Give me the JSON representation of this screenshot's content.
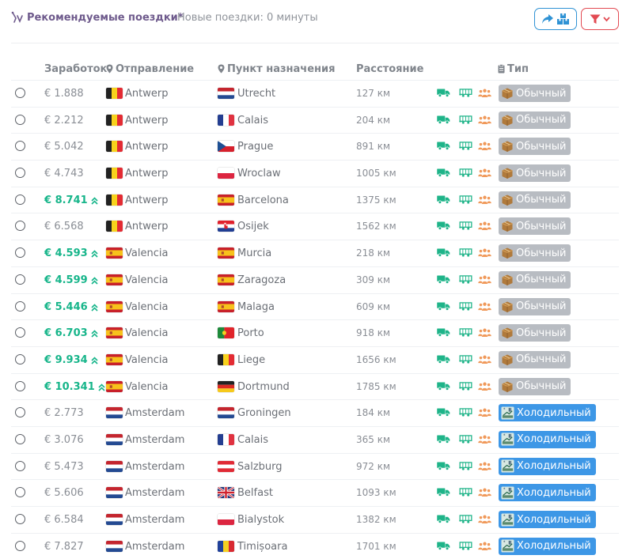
{
  "header": {
    "title": "Рекомендуемые поездки*",
    "subtitle": "Новые поездки: 0 минуты",
    "accent_color": "#6e5a8c"
  },
  "buttons": {
    "share": {
      "icon": "share-forward-icon",
      "icon2": "boxes-icon",
      "color": "#2f92d4"
    },
    "filter": {
      "icon": "filter-icon",
      "icon2": "chevron-down-icon",
      "color": "#e24a52"
    }
  },
  "columns": {
    "earnings": "Заработок",
    "origin": "Отправление",
    "destination": "Пункт назначения",
    "distance": "Расстояние",
    "type": "Тип"
  },
  "colors": {
    "highlight": "#17b58a",
    "normal_badge": "#b8bcc2",
    "cold_badge": "#3d97e6"
  },
  "rows": [
    {
      "earnings": "€ 1.888",
      "hl": false,
      "from": "Antwerp",
      "from_flag": "BE",
      "to": "Utrecht",
      "to_flag": "NL",
      "distance": "127 км",
      "type": "Обычный",
      "kind": "normal"
    },
    {
      "earnings": "€ 2.212",
      "hl": false,
      "from": "Antwerp",
      "from_flag": "BE",
      "to": "Calais",
      "to_flag": "FR",
      "distance": "204 км",
      "type": "Обычный",
      "kind": "normal"
    },
    {
      "earnings": "€ 5.042",
      "hl": false,
      "from": "Antwerp",
      "from_flag": "BE",
      "to": "Prague",
      "to_flag": "CZ",
      "distance": "891 км",
      "type": "Обычный",
      "kind": "normal"
    },
    {
      "earnings": "€ 4.743",
      "hl": false,
      "from": "Antwerp",
      "from_flag": "BE",
      "to": "Wroclaw",
      "to_flag": "PL",
      "distance": "1005 км",
      "type": "Обычный",
      "kind": "normal"
    },
    {
      "earnings": "€ 8.741",
      "hl": true,
      "from": "Antwerp",
      "from_flag": "BE",
      "to": "Barcelona",
      "to_flag": "ES",
      "distance": "1375 км",
      "type": "Обычный",
      "kind": "normal"
    },
    {
      "earnings": "€ 6.568",
      "hl": false,
      "from": "Antwerp",
      "from_flag": "BE",
      "to": "Osijek",
      "to_flag": "HR",
      "distance": "1562 км",
      "type": "Обычный",
      "kind": "normal"
    },
    {
      "earnings": "€ 4.593",
      "hl": true,
      "from": "Valencia",
      "from_flag": "ES",
      "to": "Murcia",
      "to_flag": "ES",
      "distance": "218 км",
      "type": "Обычный",
      "kind": "normal"
    },
    {
      "earnings": "€ 4.599",
      "hl": true,
      "from": "Valencia",
      "from_flag": "ES",
      "to": "Zaragoza",
      "to_flag": "ES",
      "distance": "309 км",
      "type": "Обычный",
      "kind": "normal"
    },
    {
      "earnings": "€ 5.446",
      "hl": true,
      "from": "Valencia",
      "from_flag": "ES",
      "to": "Malaga",
      "to_flag": "ES",
      "distance": "609 км",
      "type": "Обычный",
      "kind": "normal"
    },
    {
      "earnings": "€ 6.703",
      "hl": true,
      "from": "Valencia",
      "from_flag": "ES",
      "to": "Porto",
      "to_flag": "PT",
      "distance": "918 км",
      "type": "Обычный",
      "kind": "normal"
    },
    {
      "earnings": "€ 9.934",
      "hl": true,
      "from": "Valencia",
      "from_flag": "ES",
      "to": "Liege",
      "to_flag": "BE",
      "distance": "1656 км",
      "type": "Обычный",
      "kind": "normal"
    },
    {
      "earnings": "€ 10.341",
      "hl": true,
      "from": "Valencia",
      "from_flag": "ES",
      "to": "Dortmund",
      "to_flag": "DE",
      "distance": "1785 км",
      "type": "Обычный",
      "kind": "normal"
    },
    {
      "earnings": "€ 2.773",
      "hl": false,
      "from": "Amsterdam",
      "from_flag": "NL",
      "to": "Groningen",
      "to_flag": "NL",
      "distance": "184 км",
      "type": "Холодильный",
      "kind": "cold"
    },
    {
      "earnings": "€ 3.076",
      "hl": false,
      "from": "Amsterdam",
      "from_flag": "NL",
      "to": "Calais",
      "to_flag": "FR",
      "distance": "365 км",
      "type": "Холодильный",
      "kind": "cold"
    },
    {
      "earnings": "€ 5.473",
      "hl": false,
      "from": "Amsterdam",
      "from_flag": "NL",
      "to": "Salzburg",
      "to_flag": "AT",
      "distance": "972 км",
      "type": "Холодильный",
      "kind": "cold"
    },
    {
      "earnings": "€ 5.606",
      "hl": false,
      "from": "Amsterdam",
      "from_flag": "NL",
      "to": "Belfast",
      "to_flag": "GB",
      "distance": "1093 км",
      "type": "Холодильный",
      "kind": "cold"
    },
    {
      "earnings": "€ 6.584",
      "hl": false,
      "from": "Amsterdam",
      "from_flag": "NL",
      "to": "Bialystok",
      "to_flag": "PL",
      "distance": "1382 км",
      "type": "Холодильный",
      "kind": "cold"
    },
    {
      "earnings": "€ 7.827",
      "hl": false,
      "from": "Amsterdam",
      "from_flag": "NL",
      "to": "Timișoara",
      "to_flag": "RO",
      "distance": "1701 км",
      "type": "Холодильный",
      "kind": "cold"
    }
  ]
}
